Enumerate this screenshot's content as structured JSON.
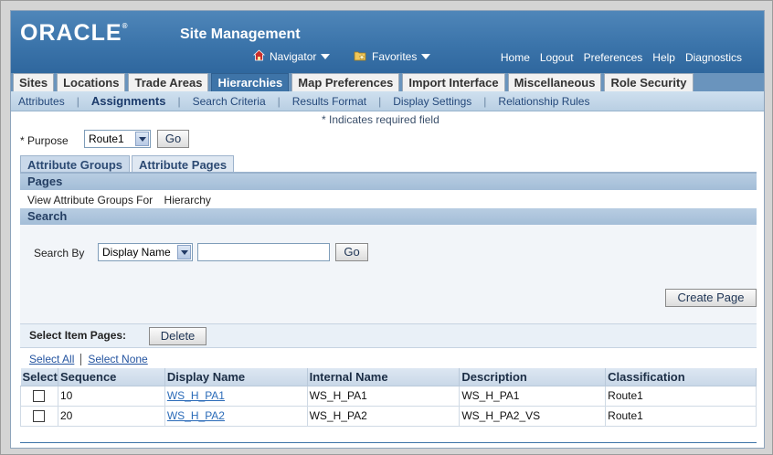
{
  "branding": {
    "logo": "ORACLE",
    "logo_mark": "®",
    "app_title": "Site Management"
  },
  "topnav": {
    "navigator_label": "Navigator",
    "favorites_label": "Favorites"
  },
  "global_links": [
    "Home",
    "Logout",
    "Preferences",
    "Help",
    "Diagnostics"
  ],
  "tabs": [
    {
      "label": "Sites",
      "active": false
    },
    {
      "label": "Locations",
      "active": false
    },
    {
      "label": "Trade Areas",
      "active": false
    },
    {
      "label": "Hierarchies",
      "active": true
    },
    {
      "label": "Map Preferences",
      "active": false
    },
    {
      "label": "Import Interface",
      "active": false
    },
    {
      "label": "Miscellaneous",
      "active": false
    },
    {
      "label": "Role Security",
      "active": false
    }
  ],
  "subtabs": [
    {
      "label": "Attributes",
      "active": false
    },
    {
      "label": "Assignments",
      "active": true
    },
    {
      "label": "Search Criteria",
      "active": false
    },
    {
      "label": "Results Format",
      "active": false
    },
    {
      "label": "Display Settings",
      "active": false
    },
    {
      "label": "Relationship Rules",
      "active": false
    }
  ],
  "required_note": "* Indicates required field",
  "purpose": {
    "label": "* Purpose",
    "value": "Route1",
    "go_label": "Go"
  },
  "attribute_tabs": [
    {
      "label": "Attribute Groups",
      "active": false
    },
    {
      "label": "Attribute Pages",
      "active": true
    }
  ],
  "pages_section": {
    "title": "Pages",
    "view_label": "View Attribute Groups For",
    "view_value": "Hierarchy"
  },
  "search_section": {
    "title": "Search",
    "search_by_label": "Search By",
    "search_by_value": "Display Name",
    "query": "",
    "go_label": "Go",
    "create_label": "Create Page"
  },
  "results": {
    "select_label": "Select Item Pages:",
    "delete_label": "Delete",
    "select_all": "Select All",
    "select_none": "Select None",
    "columns": [
      "Select",
      "Sequence",
      "Display Name",
      "Internal Name",
      "Description",
      "Classification"
    ],
    "rows": [
      {
        "sequence": "10",
        "display_name": "WS_H_PA1",
        "internal_name": "WS_H_PA1",
        "description": "WS_H_PA1",
        "classification": "Route1",
        "selected": false
      },
      {
        "sequence": "20",
        "display_name": "WS_H_PA2",
        "internal_name": "WS_H_PA2",
        "description": "WS_H_PA2_VS",
        "classification": "Route1",
        "selected": false
      }
    ]
  },
  "colors": {
    "brand_blue": "#3b74aa",
    "active_tab": "#3e74a8",
    "link": "#2454a0"
  }
}
